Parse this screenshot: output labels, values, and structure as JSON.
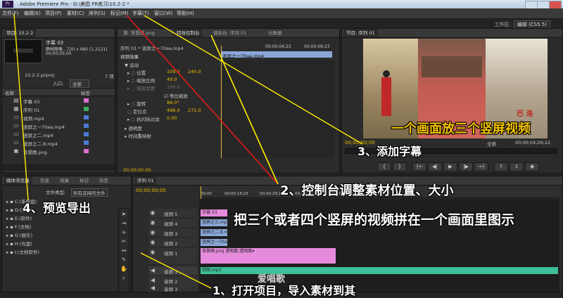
{
  "app": {
    "title": "Adobe Premiere Pro - G:\\美图 FR练习\\10.2-2 *"
  },
  "menu": [
    "文件(F)",
    "编辑(E)",
    "项目(P)",
    "素材(C)",
    "序列(S)",
    "标记(M)",
    "字幕(T)",
    "窗口(W)",
    "帮助(H)"
  ],
  "workspace": {
    "label": "工作区:",
    "value": "编辑 (CS5.5)"
  },
  "project": {
    "tab": "项目: 10.2-2",
    "clip_name": "字幕 03",
    "clip_info": "静帧图像 , 720 x 480 (1.2121)",
    "clip_duration": "00;00;05;05",
    "file": "10.2-2.prproj",
    "count": "7 项",
    "in_label": "入口:",
    "in_value": "全部",
    "col_name": "名称",
    "col_label": "标签",
    "items": [
      {
        "name": "字幕 03",
        "color": "#e070d0"
      },
      {
        "name": "序列 01",
        "color": "#3bb05a"
      },
      {
        "name": "视频.mp4",
        "color": "#4c7bd6"
      },
      {
        "name": "竖屏之一70aa.mp4",
        "color": "#4c7bd6"
      },
      {
        "name": "竖屏之二.mp4",
        "color": "#4c7bd6"
      },
      {
        "name": "竖屏之二.8.mp4",
        "color": "#4c7bd6"
      },
      {
        "name": "背景图.png",
        "color": "#e070d0"
      }
    ]
  },
  "effect_controls": {
    "tabs": [
      "源: 背景图.png",
      "特效控制台",
      "调音台: 序列 01",
      "元数据"
    ],
    "clip": "序列 01 * 竖屏之一70aa.mp4",
    "time_mid": "00;00;04;23",
    "time_end": "00;00;09;23",
    "mini_clip": "竖屏之一70aa.mp4",
    "section": "视频效果",
    "rows": [
      {
        "label": "运动",
        "v1": "",
        "v2": ""
      },
      {
        "label": "位置",
        "v1": "109.0",
        "v2": "240.0"
      },
      {
        "label": "缩放比例",
        "v1": "49.0",
        "v2": ""
      },
      {
        "label": "缩放宽度",
        "v1": "100.0",
        "v2": ""
      },
      {
        "label": "等比缩放",
        "v1": "",
        "v2": ""
      },
      {
        "label": "旋转",
        "v1": "89.0°",
        "v2": ""
      },
      {
        "label": "定位点",
        "v1": "496.0",
        "v2": "272.0"
      },
      {
        "label": "抗闪烁过滤",
        "v1": "0.00",
        "v2": ""
      },
      {
        "label": "透明度",
        "v1": "",
        "v2": ""
      },
      {
        "label": "时间重映射",
        "v1": "",
        "v2": ""
      }
    ],
    "timecode": "00:00:00:00"
  },
  "program": {
    "tab": "节目: 序列 01",
    "overlay_text": "一个画面放三个竖屏视频",
    "stamp": "巴 洛",
    "timecode": "00;00;00;00",
    "fit": "全部",
    "duration": "00;00;04;26;22"
  },
  "media": {
    "tabs": [
      "媒体浏览器",
      "信息",
      "效果",
      "标记",
      "历史"
    ],
    "type_label": "文件类型:",
    "type_value": "所有支持的文件",
    "drives": [
      "C:(系统盘)",
      "D:(软件)",
      "E:(软件)",
      "F:(文档)",
      "G:(娱乐)",
      "H:(光盘)",
      "I:(文档软件)"
    ]
  },
  "timeline": {
    "tab": "序列 01",
    "timecode": "00;00;00;00",
    "ruler": [
      "00;00",
      "00;00;14;23",
      "00;00;29;23",
      "00;00;44;22",
      "00;00;59;22",
      "00;01;14;22"
    ],
    "tracks": [
      {
        "name": "视频 5"
      },
      {
        "name": "视频 4"
      },
      {
        "name": "视频 3"
      },
      {
        "name": "视频 2"
      },
      {
        "name": "视频 1"
      },
      {
        "name": "音频 1"
      },
      {
        "name": "音频 2"
      },
      {
        "name": "音频 3"
      }
    ],
    "clips": {
      "v5": "字幕 03",
      "v4": "竖屏之三.mp",
      "v3": "竖屏之二.8.mp",
      "v2": "竖屏之一70aa",
      "v1": "背景图.png 透明度:透明度▾",
      "a1": "视频.mp3"
    }
  },
  "annotations": {
    "a1": "1、打开项目，导入素材到其",
    "a2": "2、控制台调整素材位置、大小",
    "a3": "3、添加字幕",
    "a4": "4、预览导出",
    "headline": "把三个或者四个竖屏的视频拼在一个画面里图示",
    "watermark": "爱唱歌"
  }
}
